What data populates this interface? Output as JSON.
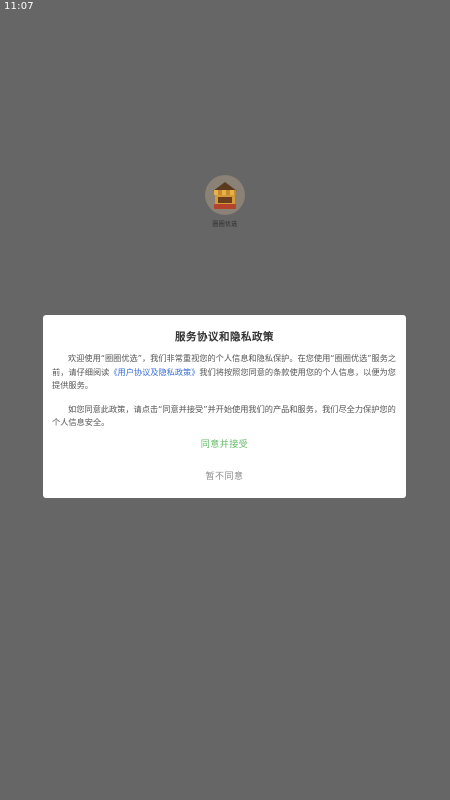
{
  "status_bar": {
    "time": "11:07"
  },
  "splash": {
    "app_name": "圈圈优选",
    "logo_text": "圈圈优选",
    "logo_icon": "shop-logo-icon"
  },
  "dialog": {
    "title": "服务协议和隐私政策",
    "para1_before_link": "欢迎使用“圈圈优选”，我们非常重视您的个人信息和隐私保护。在您使用“圈圈优选”服务之前，请仔细阅读",
    "para1_link": "《用户协议及隐私政策》",
    "para1_after_link": "我们将按照您同意的条款使用您的个人信息，以便为您提供服务。",
    "para2": "如您同意此政策，请点击“同意并接受”并开始使用我们的产品和服务，我们尽全力保护您的个人信息安全。",
    "accept_label": "同意并接受",
    "reject_label": "暂不同意"
  },
  "colors": {
    "overlay": "#666666",
    "dialog_bg": "#ffffff",
    "accept": "#66bb6a",
    "link": "#3a6fd8",
    "reject": "#8a8a8a"
  }
}
